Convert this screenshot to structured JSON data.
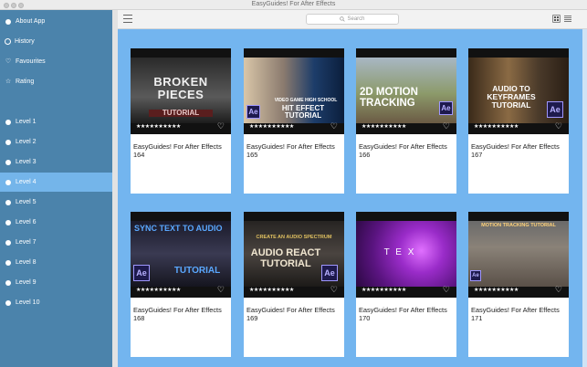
{
  "window": {
    "title": "EasyGuides! For After Effects"
  },
  "sidebar": {
    "items": [
      {
        "label": "About App",
        "icon": "dot-icon"
      },
      {
        "label": "History",
        "icon": "clock-icon"
      },
      {
        "label": "Favourites",
        "icon": "heart-icon"
      },
      {
        "label": "Rating",
        "icon": "star-icon"
      },
      {
        "label": "Level 1"
      },
      {
        "label": "Level 2"
      },
      {
        "label": "Level 3"
      },
      {
        "label": "Level 4"
      },
      {
        "label": "Level 5"
      },
      {
        "label": "Level 6"
      },
      {
        "label": "Level 7"
      },
      {
        "label": "Level 8"
      },
      {
        "label": "Level 9"
      },
      {
        "label": "Level 10"
      }
    ],
    "active_item": "Level 4"
  },
  "toolbar": {
    "search_placeholder": "Search",
    "view_modes": [
      "grid-view-icon",
      "list-view-icon"
    ],
    "active_view": "grid"
  },
  "cards": [
    {
      "label": "EasyGuides! For After Effects 164",
      "thumb_text": "BROKEN PIECES",
      "thumb_sub": "TUTORIAL",
      "ae": false
    },
    {
      "label": "EasyGuides! For After Effects 165",
      "thumb_text": "HIT EFFECT TUTORIAL",
      "thumb_sub": "VIDEO GAME HIGH SCHOOL",
      "ae": true
    },
    {
      "label": "EasyGuides! For After Effects 166",
      "thumb_text": "2D MOTION TRACKING",
      "thumb_sub": "",
      "ae": true
    },
    {
      "label": "EasyGuides! For After Effects 167",
      "thumb_text": "AUDIO TO KEYFRAMES TUTORIAL",
      "thumb_sub": "",
      "ae": true
    },
    {
      "label": "EasyGuides! For After Effects 168",
      "thumb_text": "SYNC TEXT TO AUDIO",
      "thumb_sub": "TUTORIAL",
      "ae": true
    },
    {
      "label": "EasyGuides! For After Effects 169",
      "thumb_text": "AUDIO REACT TUTORIAL",
      "thumb_sub": "CREATE AN AUDIO SPECTRUM",
      "ae": true
    },
    {
      "label": "EasyGuides! For After Effects 170",
      "thumb_text": "T E X",
      "thumb_sub": "",
      "ae": false
    },
    {
      "label": "EasyGuides! For After Effects 171",
      "thumb_text": "MOTION TRACKING TUTORIAL",
      "thumb_sub": "",
      "ae": true
    }
  ],
  "rating_stars": "★★★★★★★★★★",
  "colors": {
    "sidebar": "#4b83ab",
    "sidebar_active": "#74b5ea",
    "content_bg": "#73b5ef"
  }
}
